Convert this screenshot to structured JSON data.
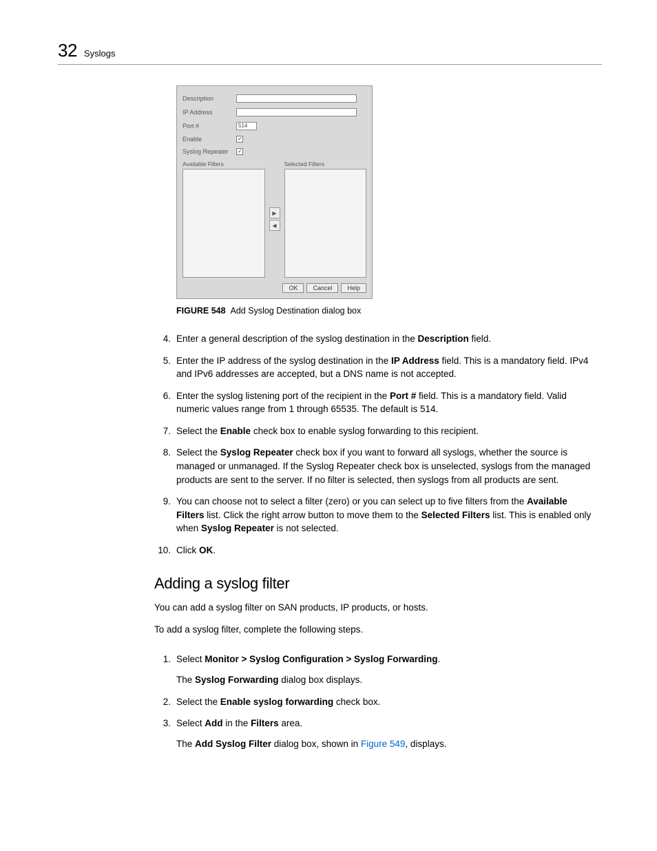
{
  "header": {
    "number": "32",
    "title": "Syslogs"
  },
  "dialog": {
    "labels": {
      "description": "Description",
      "ip": "IP Address",
      "port": "Port #",
      "enable": "Enable",
      "repeater": "Syslog Repeater",
      "available": "Available Filters",
      "selected": "Selected Filters"
    },
    "port_value": "514",
    "buttons": {
      "ok": "OK",
      "cancel": "Cancel",
      "help": "Help"
    }
  },
  "figure": {
    "label": "FIGURE 548",
    "caption": "Add Syslog Destination dialog box"
  },
  "steps_a": [
    {
      "n": "4.",
      "pre": "Enter a general description of the syslog destination in the ",
      "b1": "Description",
      "post": " field."
    },
    {
      "n": "5.",
      "pre": "Enter the IP address of the syslog destination in the ",
      "b1": "IP Address",
      "post": " field. This is a mandatory field. IPv4 and IPv6 addresses are accepted, but a DNS name is not accepted."
    },
    {
      "n": "6.",
      "pre": "Enter the syslog listening port of the recipient in the ",
      "b1": "Port #",
      "post": " field. This is a mandatory field. Valid numeric values range from 1 through 65535. The default is 514."
    },
    {
      "n": "7.",
      "pre": "Select the ",
      "b1": "Enable",
      "post": " check box to enable syslog forwarding to this recipient."
    }
  ],
  "step8": {
    "n": "8.",
    "t1": "Select the ",
    "b1": "Syslog Repeater",
    "t2": " check box if you want to forward all syslogs, whether the source is managed or unmanaged. If the Syslog Repeater check box is unselected, syslogs from the managed products are sent to the server. If no filter is selected, then syslogs from all products are sent."
  },
  "step9": {
    "n": "9.",
    "t1": "You can choose not to select a filter (zero) or you can select up to five filters from the ",
    "b1": "Available Filters",
    "t2": " list. Click the right arrow button to move them to the ",
    "b2": "Selected Filters",
    "t3": " list. This is enabled only when ",
    "b3": "Syslog Repeater",
    "t4": " is not selected."
  },
  "step10": {
    "n": "10.",
    "t1": "Click ",
    "b1": "OK",
    "t2": "."
  },
  "section2": {
    "heading": "Adding a syslog filter",
    "intro1": "You can add a syslog filter on SAN products, IP products, or hosts.",
    "intro2": "To add a syslog filter, complete the following steps."
  },
  "steps_b": {
    "s1": {
      "n": "1.",
      "t1": "Select ",
      "b1": "Monitor > Syslog Configuration > Syslog Forwarding",
      "t2": ".",
      "sub_t1": "The ",
      "sub_b1": "Syslog Forwarding",
      "sub_t2": " dialog box displays."
    },
    "s2": {
      "n": "2.",
      "t1": "Select the ",
      "b1": "Enable syslog forwarding",
      "t2": " check box."
    },
    "s3": {
      "n": "3.",
      "t1": "Select ",
      "b1": "Add",
      "t2": " in the ",
      "b2": "Filters",
      "t3": " area.",
      "sub_t1": "The ",
      "sub_b1": "Add Syslog Filter",
      "sub_t2": " dialog box, shown in ",
      "sub_link": "Figure 549",
      "sub_t3": ", displays."
    }
  }
}
